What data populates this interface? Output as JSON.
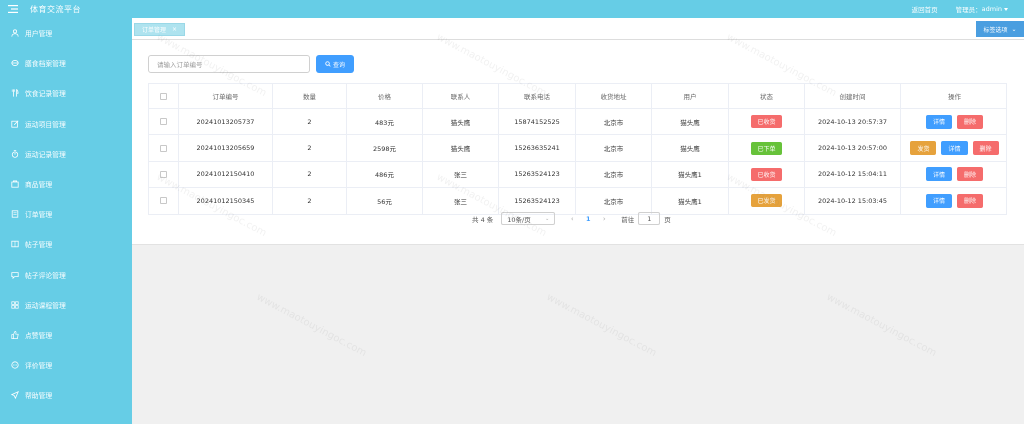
{
  "header": {
    "title": "体育交流平台",
    "back_home": "返回首页",
    "admin_label": "管理员：",
    "admin_name": "admin"
  },
  "sidebar": {
    "items": [
      {
        "label": "用户管理",
        "icon": "user-icon"
      },
      {
        "label": "膳食档案管理",
        "icon": "meal-icon"
      },
      {
        "label": "饮食记录管理",
        "icon": "utensils-icon"
      },
      {
        "label": "运动项目管理",
        "icon": "edit-icon"
      },
      {
        "label": "运动记录管理",
        "icon": "stopwatch-icon"
      },
      {
        "label": "商品管理",
        "icon": "goods-icon"
      },
      {
        "label": "订单管理",
        "icon": "order-icon"
      },
      {
        "label": "帖子管理",
        "icon": "post-icon"
      },
      {
        "label": "帖子评论管理",
        "icon": "comment-icon"
      },
      {
        "label": "运动课程管理",
        "icon": "course-icon"
      },
      {
        "label": "点赞管理",
        "icon": "thumb-icon"
      },
      {
        "label": "评价管理",
        "icon": "review-icon"
      },
      {
        "label": "帮助管理",
        "icon": "send-icon"
      }
    ]
  },
  "tags": {
    "active": "订单管理",
    "close": "×",
    "options": "标签选项"
  },
  "search": {
    "placeholder": "请输入订单编号",
    "button": "查询"
  },
  "table": {
    "headers": [
      "订单编号",
      "数量",
      "价格",
      "联系人",
      "联系电话",
      "收货地址",
      "用户",
      "状态",
      "创建时间",
      "操作"
    ],
    "rows": [
      {
        "order_no": "20241013205737",
        "qty": "2",
        "price": "483元",
        "contact": "猫头鹰",
        "phone": "15874152525",
        "address": "北京市",
        "user": "猫头鹰",
        "status": "已收货",
        "created": "2024-10-13 20:57:37",
        "actions": [
          "详情",
          "删除"
        ]
      },
      {
        "order_no": "20241013205659",
        "qty": "2",
        "price": "2598元",
        "contact": "猫头鹰",
        "phone": "15263635241",
        "address": "北京市",
        "user": "猫头鹰",
        "status": "已下单",
        "created": "2024-10-13 20:57:00",
        "actions": [
          "发货",
          "详情",
          "删除"
        ]
      },
      {
        "order_no": "20241012150410",
        "qty": "2",
        "price": "486元",
        "contact": "张三",
        "phone": "15263524123",
        "address": "北京市",
        "user": "猫头鹰1",
        "status": "已收货",
        "created": "2024-10-12 15:04:11",
        "actions": [
          "详情",
          "删除"
        ]
      },
      {
        "order_no": "20241012150345",
        "qty": "2",
        "price": "56元",
        "contact": "张三",
        "phone": "15263524123",
        "address": "北京市",
        "user": "猫头鹰1",
        "status": "已发货",
        "created": "2024-10-12 15:03:45",
        "actions": [
          "详情",
          "删除"
        ]
      }
    ]
  },
  "status_colors": {
    "已收货": "#f56c6c",
    "已下单": "#67c23a",
    "已发货": "#e6a23c"
  },
  "pagination": {
    "total": "共 4 条",
    "page_size": "10条/页",
    "prev": "‹",
    "current": "1",
    "next": "›",
    "goto_label": "前往",
    "goto_value": "1",
    "goto_suffix": "页"
  },
  "watermark": "www.maotouyingoc.com"
}
